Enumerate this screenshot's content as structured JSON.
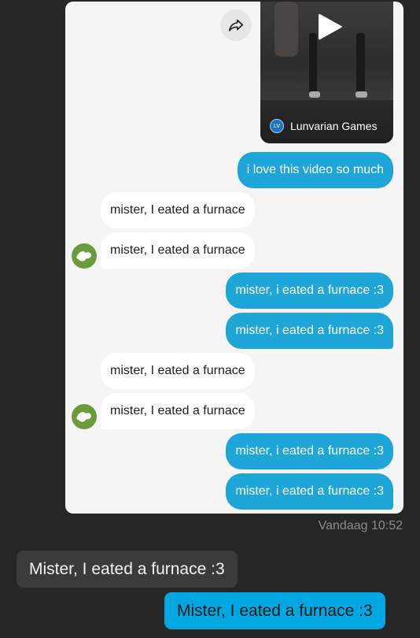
{
  "screenshot": {
    "channel_name": "Lunvarian Games",
    "channel_logo_text": "LV",
    "messages": [
      {
        "from": "me",
        "text": "i love this video so much"
      },
      {
        "from": "other",
        "text": "mister, I eated a furnace"
      },
      {
        "from": "other",
        "text": "mister, I eated a furnace"
      },
      {
        "from": "me",
        "text": "mister, i eated a furnace :3"
      },
      {
        "from": "me",
        "text": "mister, i eated a furnace :3"
      },
      {
        "from": "other",
        "text": "mister, I eated a furnace"
      },
      {
        "from": "other",
        "text": "mister, I eated a furnace"
      },
      {
        "from": "me",
        "text": "mister, i eated a furnace :3"
      },
      {
        "from": "me",
        "text": "mister, i eated a furnace :3"
      }
    ]
  },
  "chat": {
    "timestamp": "Vandaag 10:52",
    "received_text": "Mister, I eated a furnace :3",
    "sent_text": "Mister, I eated a furnace :3"
  },
  "colors": {
    "background": "#262626",
    "screenshot_bg": "#f5f5f5",
    "sent_bubble_inner": "#1ea6d9",
    "sent_bubble_outer": "#00a7e1",
    "received_bubble_outer": "#3b3b3b"
  },
  "icons": {
    "share": "share-arrow-icon",
    "play": "play-icon",
    "avatar": "green-avatar-icon"
  }
}
